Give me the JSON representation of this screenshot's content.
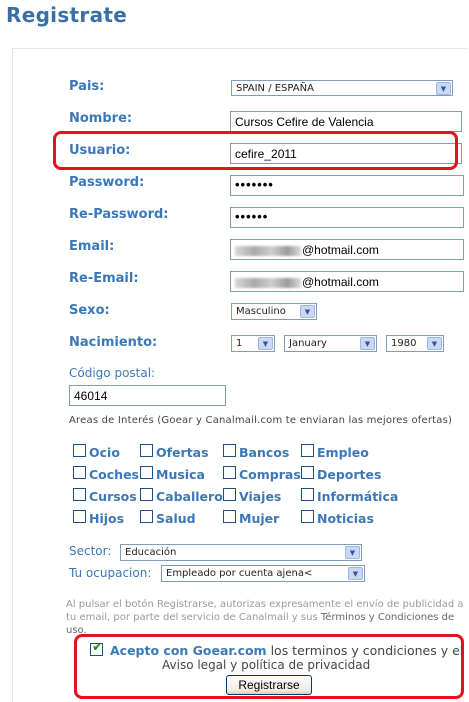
{
  "page_title": "Registrate",
  "fields": {
    "pais": {
      "label": "Pais:",
      "value": "SPAIN / ESPAÑA"
    },
    "nombre": {
      "label": "Nombre:",
      "value": "Cursos Cefire de Valencia"
    },
    "usuario": {
      "label": "Usuario:",
      "value": "cefire_2011"
    },
    "password": {
      "label": "Password:",
      "value": "•••••••"
    },
    "repassword": {
      "label": "Re-Password:",
      "value": "••••••"
    },
    "email": {
      "label": "Email:",
      "value_suffix": "@hotmail.com"
    },
    "reemail": {
      "label": "Re-Email:",
      "value_suffix": "@hotmail.com"
    },
    "sexo": {
      "label": "Sexo:",
      "value": "Masculino"
    },
    "nacimiento": {
      "label": "Nacimiento:",
      "day": "1",
      "month": "January",
      "year": "1980"
    },
    "codigo_postal": {
      "label": "Código postal:",
      "value": "46014"
    }
  },
  "interests": {
    "note": "Areas de Interés (Goear y Canalmail.com te enviaran las mejores ofertas)",
    "items": [
      "Ocio",
      "Ofertas",
      "Bancos",
      "Empleo",
      "Coches",
      "Musica",
      "Compras",
      "Deportes",
      "Cursos",
      "Caballero",
      "Viajes",
      "Informática",
      "Hijos",
      "Salud",
      "Mujer",
      "Noticias"
    ]
  },
  "sector": {
    "label": "Sector:",
    "value": "Educación"
  },
  "ocupacion": {
    "label": "Tu ocupacion:",
    "value": "Empleado por cuenta ajena<"
  },
  "legal_text": "Al pulsar el botón Registrarse, autorizas expresamente el envío de publicidad a tu email, por parte del servicio de Canalmail y sus",
  "legal_link": "Términos y Condiciones de uso.",
  "accept": {
    "part1": "Acepto con Goear.com",
    "part2": "los terminos y condiciones y el",
    "part3": "Aviso legal y política de privacidad"
  },
  "submit_label": "Registrarse",
  "colors": {
    "label_blue": "#3d78b6",
    "title_blue": "#3a6fa3",
    "highlight_red": "#e3131b"
  }
}
